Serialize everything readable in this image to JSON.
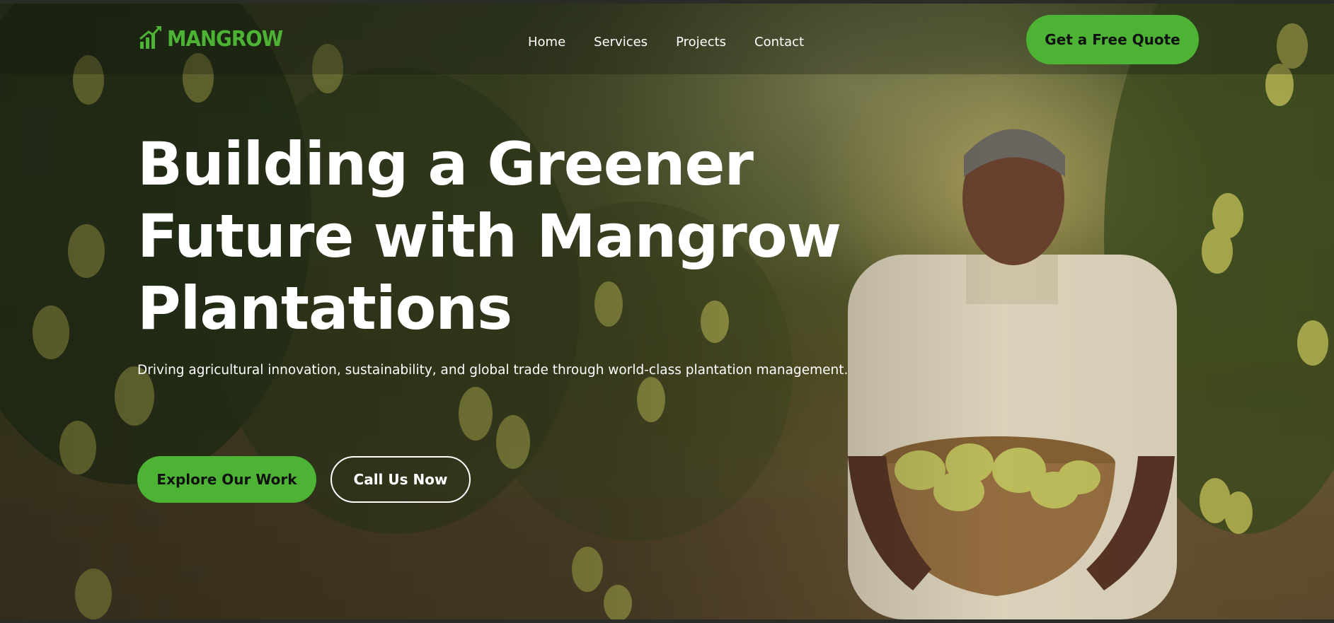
{
  "brand": {
    "name": "MANGROW",
    "accent_color": "#4db335",
    "logo_icon": "growth-chart-icon"
  },
  "nav": {
    "links": [
      "Home",
      "Services",
      "Projects",
      "Contact"
    ],
    "cta_label": "Get a Free Quote"
  },
  "hero": {
    "title_lines": [
      "Building a Greener",
      "Future with Mangrow",
      "Plantations"
    ],
    "subtitle": "Driving agricultural innovation, sustainability, and global trade through world-class plantation management.",
    "primary_button": "Explore Our Work",
    "secondary_button": "Call Us Now",
    "background_image": "farmer-holding-mango-basket-in-orchard"
  }
}
